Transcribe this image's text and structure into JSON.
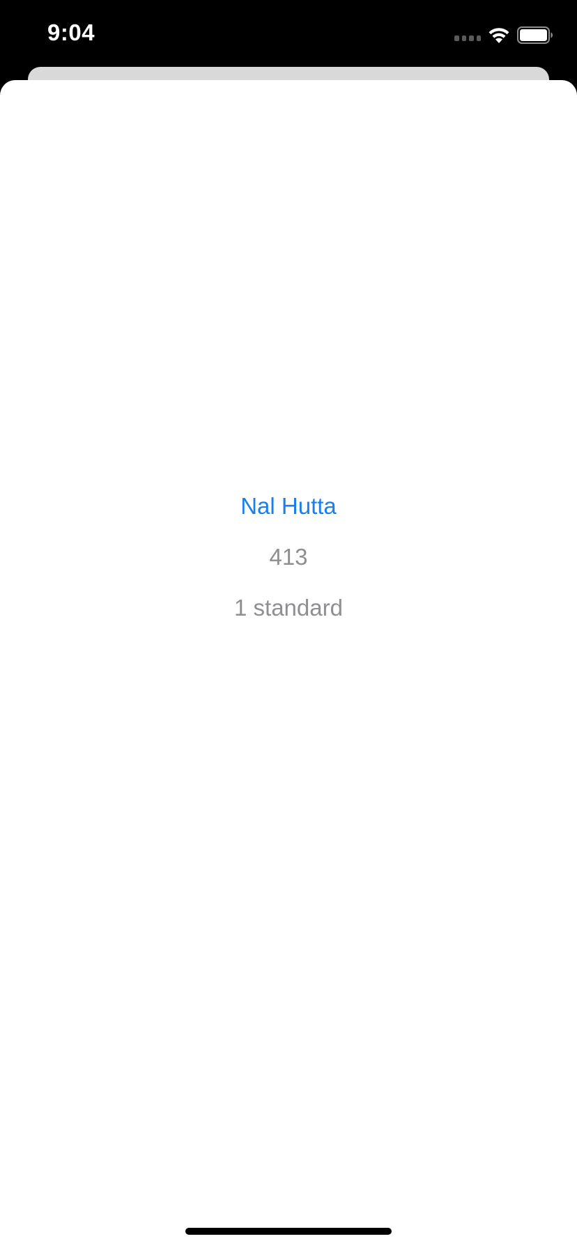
{
  "status_bar": {
    "time": "9:04",
    "icons": [
      "cellular-signal-icon",
      "wifi-icon",
      "battery-icon"
    ]
  },
  "sheet": {
    "name_link": "Nal Hutta",
    "number": "413",
    "detail": "1 standard"
  },
  "colors": {
    "link": "#1a7fe6",
    "secondary_text": "#8e8e93",
    "background": "#000000",
    "sheet": "#ffffff"
  }
}
